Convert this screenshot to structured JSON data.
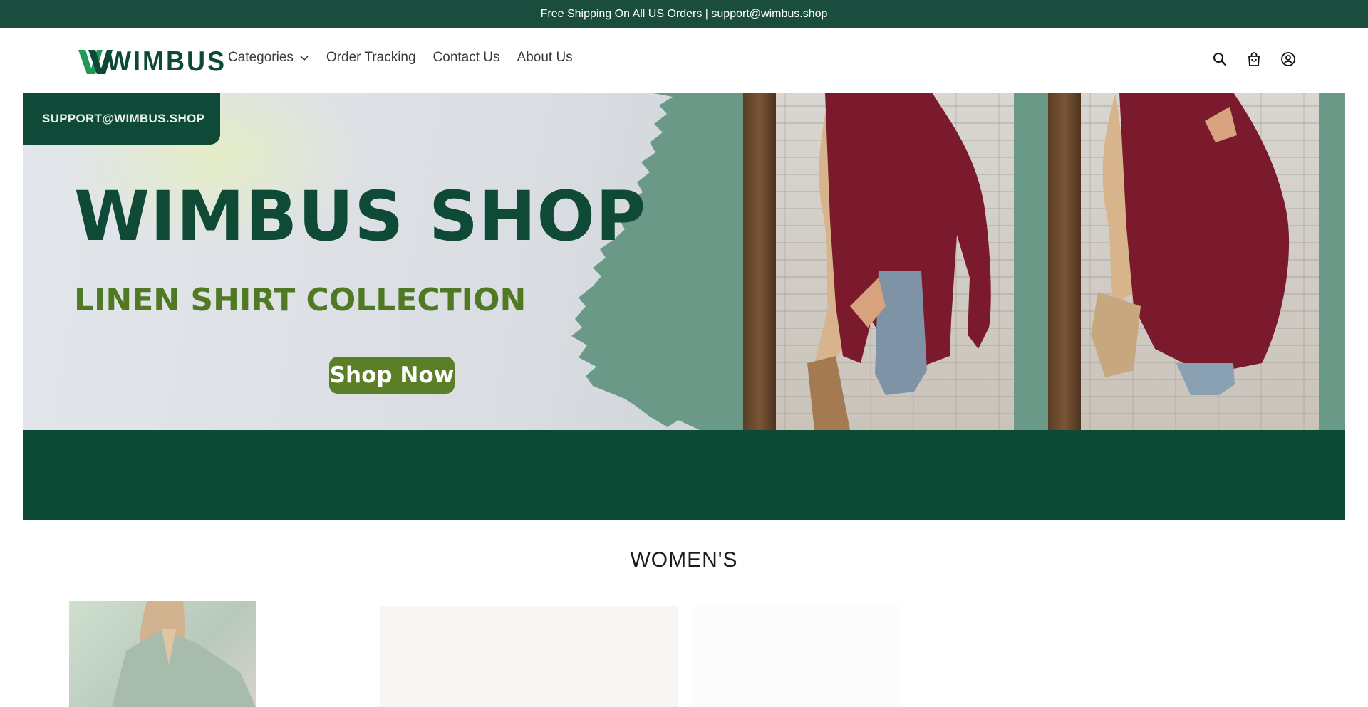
{
  "announcement": {
    "text": "Free Shipping On All US Orders | support@wimbus.shop"
  },
  "header": {
    "logo_text": "WIMBUS",
    "nav": {
      "categories": "Categories",
      "order_tracking": "Order Tracking",
      "contact_us": "Contact Us",
      "about_us": "About Us"
    },
    "icons": [
      "search-icon",
      "cart-icon",
      "account-icon"
    ]
  },
  "hero": {
    "support_tab": "SUPPORT@WIMBUS.SHOP",
    "title": "WIMBUS SHOP",
    "subtitle": "LINEN SHIRT COLLECTION",
    "cta": "Shop Now"
  },
  "section": {
    "title": "WOMEN'S"
  },
  "colors": {
    "brand_green": "#1b4d3e",
    "hero_green": "#0b4a35",
    "accent_olive": "#5b7f27",
    "shirt_red": "#7a1a2c",
    "sage": "#6a9a87"
  }
}
